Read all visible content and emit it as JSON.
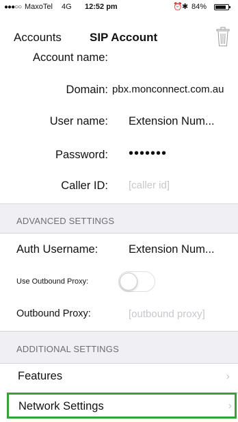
{
  "status_bar": {
    "signal": "●●●○○",
    "carrier": "MaxoTel",
    "network": "4G",
    "time": "12:52 pm",
    "alarm_icon": "alarm-icon",
    "bluetooth_icon": "bluetooth-icon",
    "battery_text": "84%",
    "battery_level": 0.84
  },
  "nav": {
    "back_label": "Accounts",
    "title": "SIP Account",
    "trash_icon": "trash-icon"
  },
  "account": {
    "account_name_label": "Account name:",
    "domain_label": "Domain:",
    "domain_value": "pbx.monconnect.com.au",
    "username_label": "User name:",
    "username_value": "Extension Num...",
    "password_label": "Password:",
    "password_value": "•••••••",
    "callerid_label": "Caller ID:",
    "callerid_placeholder": "[caller id]"
  },
  "advanced": {
    "section_title": "ADVANCED SETTINGS",
    "auth_username_label": "Auth Username:",
    "auth_username_value": "Extension Num...",
    "outbound_proxy_toggle_label": "Use Outbound Proxy:",
    "outbound_proxy_enabled": false,
    "outbound_proxy_label": "Outbound Proxy:",
    "outbound_proxy_placeholder": "[outbound proxy]"
  },
  "additional": {
    "section_title": "ADDITIONAL SETTINGS",
    "features_label": "Features",
    "network_settings_label": "Network Settings",
    "chevron_icon": "chevron-right-icon"
  },
  "colors": {
    "highlight_border": "#33a33a",
    "section_bg": "#efeff4",
    "placeholder_text": "#c8c8cc"
  }
}
